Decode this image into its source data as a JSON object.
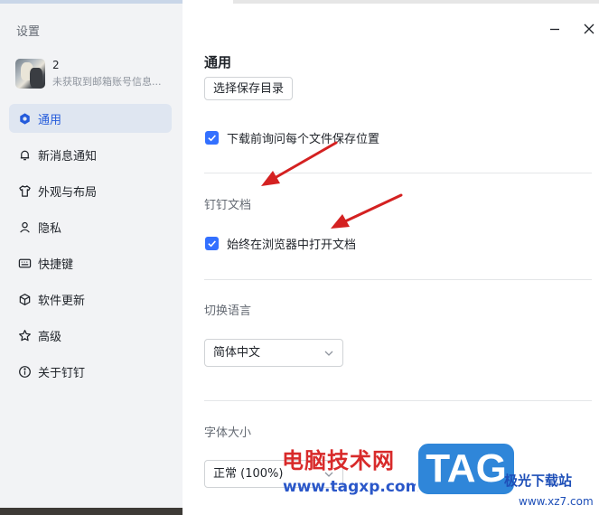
{
  "sidebar": {
    "title": "设置",
    "profile": {
      "name": "2",
      "subtitle": "未获取到邮箱账号信息..."
    },
    "items": [
      {
        "label": "通用",
        "icon": "general-icon",
        "active": true
      },
      {
        "label": "新消息通知",
        "icon": "bell-icon"
      },
      {
        "label": "外观与布局",
        "icon": "shirt-icon"
      },
      {
        "label": "隐私",
        "icon": "person-icon"
      },
      {
        "label": "快捷键",
        "icon": "keyboard-icon"
      },
      {
        "label": "软件更新",
        "icon": "cube-icon"
      },
      {
        "label": "高级",
        "icon": "star-icon"
      },
      {
        "label": "关于钉钉",
        "icon": "info-icon"
      }
    ]
  },
  "window": {
    "minimize_icon": "minimize-icon",
    "close_icon": "close-icon"
  },
  "general": {
    "title": "通用",
    "choose_dir_button": "选择保存目录",
    "ask_each_file": {
      "label": "下载前询问每个文件保存位置",
      "checked": true
    }
  },
  "docs": {
    "title": "钉钉文档",
    "open_in_browser": {
      "label": "始终在浏览器中打开文档",
      "checked": true
    }
  },
  "language": {
    "title": "切换语言",
    "selected": "简体中文"
  },
  "font_size": {
    "title": "字体大小",
    "selected": "正常 (100%)"
  },
  "watermark": {
    "cn_text": "电脑技术网",
    "url": "www.tagxp.com",
    "logo": "TAG",
    "site_cn": "极光下载站",
    "site_url": "www.xz7.com"
  },
  "colors": {
    "accent": "#3370ff",
    "active_nav_bg": "#dfe6f1",
    "arrow": "#d42121"
  }
}
